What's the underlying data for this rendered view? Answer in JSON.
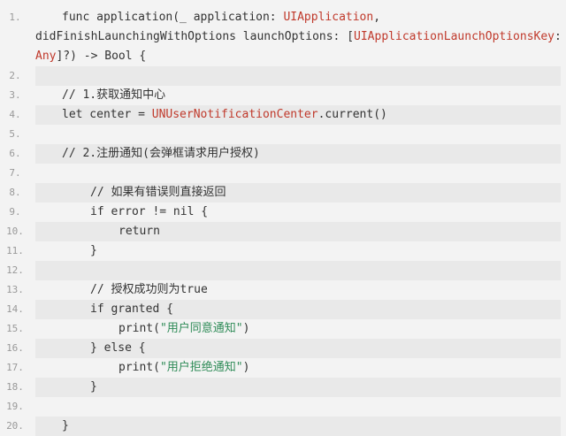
{
  "lines": [
    {
      "n": "1.",
      "indent": 1,
      "parts": [
        {
          "t": "func application(_ application: ",
          "c": "kw"
        },
        {
          "t": "UIApplication",
          "c": "ty"
        },
        {
          "t": ",",
          "c": "kw"
        }
      ],
      "wrap": [
        [
          {
            "t": "didFinishLaunchingWithOptions launchOptions: [",
            "c": "kw"
          },
          {
            "t": "UIApplicationLaunchOptionsKey",
            "c": "ty"
          },
          {
            "t": ":",
            "c": "kw"
          }
        ],
        [
          {
            "t": "Any",
            "c": "ty"
          },
          {
            "t": "]?) -> ",
            "c": "kw"
          },
          {
            "t": "Bool",
            "c": "kw"
          },
          {
            "t": " {",
            "c": "kw"
          }
        ]
      ]
    },
    {
      "n": "2.",
      "indent": 0,
      "parts": []
    },
    {
      "n": "3.",
      "indent": 1,
      "parts": [
        {
          "t": "// 1.获取通知中心",
          "c": "cm"
        }
      ]
    },
    {
      "n": "4.",
      "indent": 1,
      "parts": [
        {
          "t": "let center = ",
          "c": "kw"
        },
        {
          "t": "UNUserNotificationCenter",
          "c": "ty"
        },
        {
          "t": ".current()",
          "c": "kw"
        }
      ]
    },
    {
      "n": "5.",
      "indent": 0,
      "parts": []
    },
    {
      "n": "6.",
      "indent": 1,
      "parts": [
        {
          "t": "// 2.注册通知(会弹框请求用户授权)",
          "c": "cm"
        }
      ]
    },
    {
      "n": "7.",
      "indent": 0,
      "parts": []
    },
    {
      "n": "8.",
      "indent": 2,
      "parts": [
        {
          "t": "// 如果有错误则直接返回",
          "c": "cm"
        }
      ]
    },
    {
      "n": "9.",
      "indent": 2,
      "parts": [
        {
          "t": "if error != nil {",
          "c": "kw"
        }
      ]
    },
    {
      "n": "10.",
      "indent": 3,
      "parts": [
        {
          "t": "return",
          "c": "kw"
        }
      ]
    },
    {
      "n": "11.",
      "indent": 2,
      "parts": [
        {
          "t": "}",
          "c": "kw"
        }
      ]
    },
    {
      "n": "12.",
      "indent": 0,
      "parts": []
    },
    {
      "n": "13.",
      "indent": 2,
      "parts": [
        {
          "t": "// 授权成功则为true",
          "c": "cm"
        }
      ]
    },
    {
      "n": "14.",
      "indent": 2,
      "parts": [
        {
          "t": "if granted {",
          "c": "kw"
        }
      ]
    },
    {
      "n": "15.",
      "indent": 3,
      "parts": [
        {
          "t": "print(",
          "c": "kw"
        },
        {
          "t": "\"用户同意通知\"",
          "c": "str"
        },
        {
          "t": ")",
          "c": "kw"
        }
      ]
    },
    {
      "n": "16.",
      "indent": 2,
      "parts": [
        {
          "t": "} else {",
          "c": "kw"
        }
      ]
    },
    {
      "n": "17.",
      "indent": 3,
      "parts": [
        {
          "t": "print(",
          "c": "kw"
        },
        {
          "t": "\"用户拒绝通知\"",
          "c": "str"
        },
        {
          "t": ")",
          "c": "kw"
        }
      ]
    },
    {
      "n": "18.",
      "indent": 2,
      "parts": [
        {
          "t": "}",
          "c": "kw"
        }
      ]
    },
    {
      "n": "19.",
      "indent": 0,
      "parts": []
    },
    {
      "n": "20.",
      "indent": 1,
      "parts": [
        {
          "t": "}",
          "c": "kw"
        }
      ]
    }
  ],
  "colors": {
    "background": "#f3f3f3",
    "alt_row": "#e9e9e9",
    "type": "#c0392b",
    "string": "#2e8b57",
    "line_number": "#999999"
  }
}
